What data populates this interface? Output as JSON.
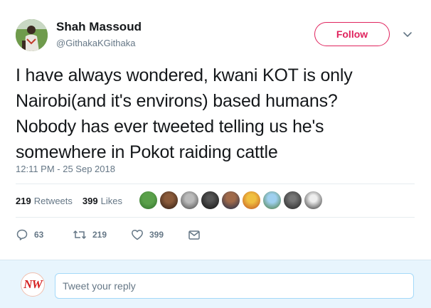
{
  "author": {
    "name": "Shah Massoud",
    "handle": "@GithakaKGithaka"
  },
  "follow_label": "Follow",
  "tweet": {
    "lines": [
      "I have always wondered, kwani KOT is only",
      "Nairobi(and it's environs) based humans?",
      "Nobody has ever tweeted telling us he's",
      "somewhere in Pokot raiding cattle"
    ],
    "timestamp": "12:11 PM - 25 Sep 2018"
  },
  "stats": {
    "retweets_count": "219",
    "retweets_label": "Retweets",
    "likes_count": "399",
    "likes_label": "Likes"
  },
  "actions": {
    "reply_count": "63",
    "retweet_count": "219",
    "like_count": "399"
  },
  "reply": {
    "avatar_text": "NW",
    "placeholder": "Tweet your reply"
  },
  "colors": {
    "accent": "#e0245e",
    "text_secondary": "#657786",
    "reply_bg": "#e8f5fd"
  },
  "icons": {
    "reply": "reply-icon",
    "retweet": "retweet-icon",
    "like": "heart-icon",
    "dm": "envelope-icon",
    "caret": "chevron-down-icon"
  }
}
